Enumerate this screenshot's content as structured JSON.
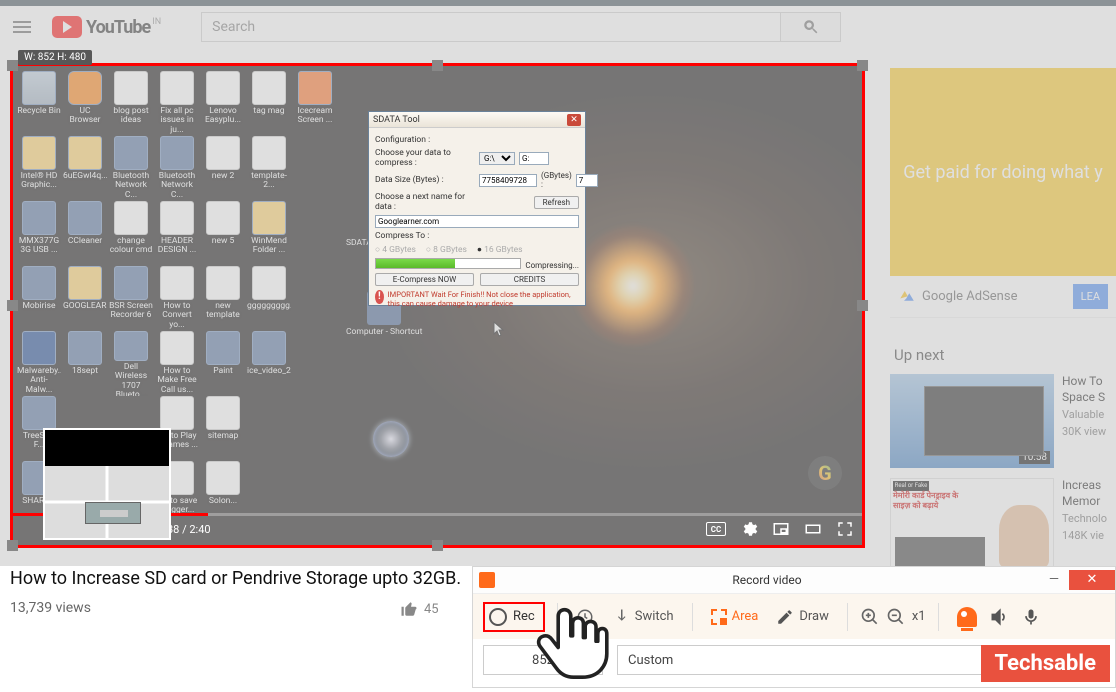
{
  "topbar": {
    "logo_text": "YouTube",
    "country": "IN",
    "search_placeholder": "Search"
  },
  "selection_label": "W: 852 H: 480",
  "video": {
    "time_display": "38 / 2:40",
    "title": "How to Increase SD card or Pendrive Storage upto 32GB.",
    "views": "13,739 views",
    "likes": "45"
  },
  "desktop_icons": [
    "Recycle Bin",
    "UC Browser",
    "blog post ideas",
    "Fix all pc issues in ju...",
    "Lenovo Easyplu...",
    "tag mag",
    "Icecream Screen ...",
    "Intel® HD Graphic...",
    "6uEGwl4q...",
    "Bluetooth Network C...",
    "Bluetooth Network C...",
    "new 2",
    "template-2...",
    "",
    "MMX377G 3G USB ...",
    "CCleaner",
    "change colour cmd",
    "HEADER DESIGN ...",
    "new 5",
    "WinMend Folder ...",
    "",
    "Mobirise",
    "GOOGLEAR...",
    "BSR Screen Recorder 6",
    "How to Convert yo...",
    "new template",
    "ggggggggg...",
    "",
    "Malwareby... Anti-Malw...",
    "18sept",
    "Dell Wireless 1707 Blueto...",
    "How to Make Free Call us...",
    "Paint",
    "ice_video_2...",
    "",
    "TreeSize F...",
    "",
    "",
    "ow to Play P games ...",
    "sitemap",
    "",
    "",
    "SHARE...",
    "",
    "",
    "ow to save blogger...",
    "Solon...",
    "",
    ""
  ],
  "extra_icons": {
    "sdata_label": "SDATA...",
    "computer_shortcut": "Computer - Shortcut"
  },
  "sdata": {
    "title": "SDATA Tool",
    "config_label": "Configuration :",
    "choose_data": "Choose your data to compress :",
    "drive1": "G:\\",
    "drive2": "G:",
    "data_size_label": "Data Size (Bytes) :",
    "data_size_value": "7758409728",
    "gbytes_label": "(GBytes) :",
    "gbytes_value": "7",
    "next_name_label": "Choose a next name for data :",
    "refresh": "Refresh",
    "name_value": "Googlearner.com",
    "compress_to": "Compress To :",
    "r1": "4 GBytes",
    "r2": "8 GBytes",
    "r3": "16 GBytes",
    "compressing": "Compressing...",
    "ecompress": "E-Compress NOW",
    "credits": "CREDITS",
    "warning": "IMPORTANT Wait For Finish!! Not close the application, this can cause damage to your device"
  },
  "right": {
    "ad_text": "Get paid for doing what y",
    "adsense_text": "Google AdSense",
    "learn": "LEA",
    "upnext": "Up next",
    "sugg1": {
      "title": "How To",
      "line2": "Space S",
      "channel": "Valuable",
      "views": "30K view",
      "duration": "10:58"
    },
    "sugg2": {
      "title": "Increas",
      "line2": "Memor",
      "channel": "Technolo",
      "views": "148K vie",
      "realfake": "Real or Fake",
      "hindi1": "मेमोरी कार्ड पेनड्राइव के",
      "hindi2": "साइज़ को बढ़ाये"
    }
  },
  "recorder": {
    "title": "Record video",
    "rec": "Rec",
    "switch": "Switch",
    "area": "Area",
    "draw": "Draw",
    "zoom": "x1",
    "width": "852",
    "preset": "Custom"
  },
  "badge": "Techsable"
}
